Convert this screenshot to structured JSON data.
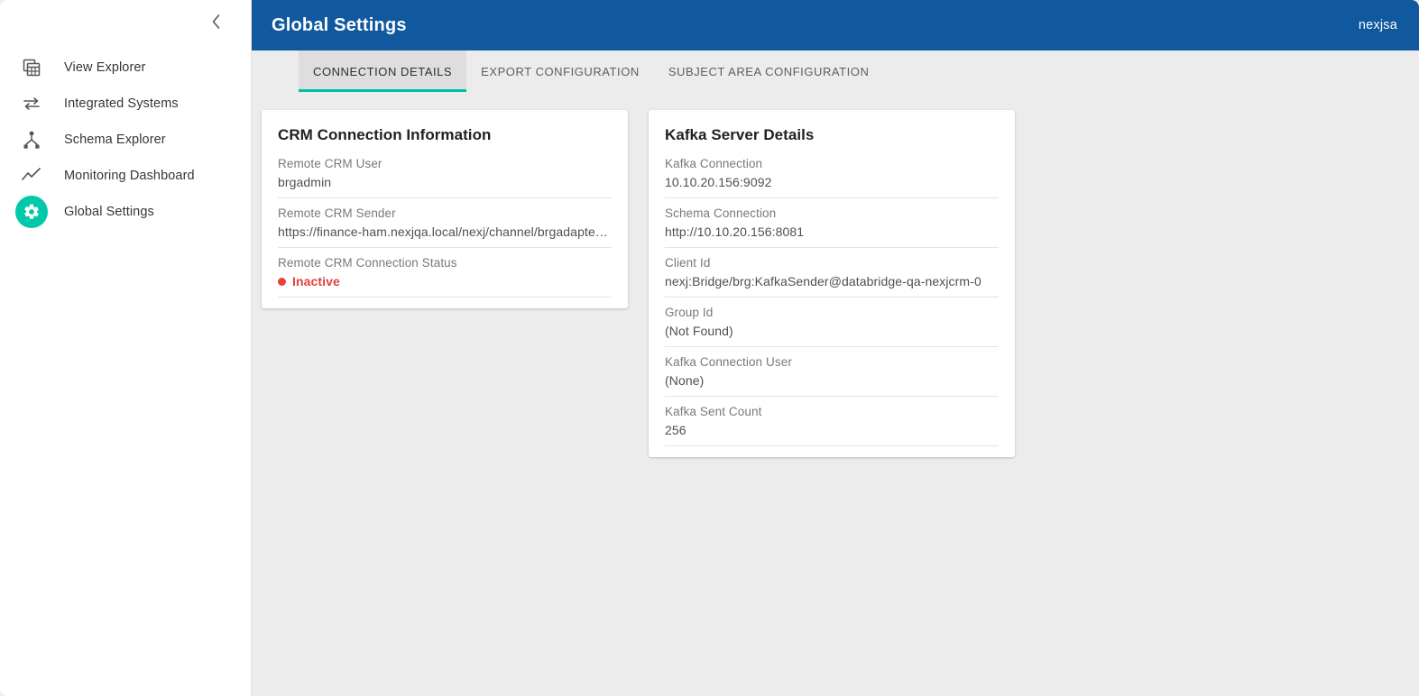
{
  "sidebar": {
    "collapse_icon": "chevron-left-icon",
    "items": [
      {
        "label": "View Explorer",
        "icon": "table-copy-icon",
        "active": false
      },
      {
        "label": "Integrated Systems",
        "icon": "exchange-arrows-icon",
        "active": false
      },
      {
        "label": "Schema Explorer",
        "icon": "sitemap-icon",
        "active": false
      },
      {
        "label": "Monitoring Dashboard",
        "icon": "line-chart-icon",
        "active": false
      },
      {
        "label": "Global Settings",
        "icon": "gear-icon",
        "active": true
      }
    ]
  },
  "topbar": {
    "title": "Global Settings",
    "user": "nexjsa",
    "bg_color": "#10599e"
  },
  "tabs": [
    {
      "label": "CONNECTION DETAILS",
      "active": true
    },
    {
      "label": "EXPORT CONFIGURATION",
      "active": false
    },
    {
      "label": "SUBJECT AREA CONFIGURATION",
      "active": false
    }
  ],
  "accent_color": "#00bfa5",
  "status_color": "#e5413d",
  "cards": {
    "crm": {
      "title": "CRM Connection Information",
      "fields": [
        {
          "label": "Remote CRM User",
          "value": "brgadmin"
        },
        {
          "label": "Remote CRM Sender",
          "value": "https://finance-ham.nexjqa.local/nexj/channel/brgadapter:C…"
        },
        {
          "label": "Remote CRM Connection Status",
          "value": "Inactive",
          "status": true
        }
      ]
    },
    "kafka": {
      "title": "Kafka Server Details",
      "fields": [
        {
          "label": "Kafka Connection",
          "value": "10.10.20.156:9092"
        },
        {
          "label": "Schema Connection",
          "value": "http://10.10.20.156:8081"
        },
        {
          "label": "Client Id",
          "value": "nexj:Bridge/brg:KafkaSender@databridge-qa-nexjcrm-0"
        },
        {
          "label": "Group Id",
          "value": "(Not Found)"
        },
        {
          "label": "Kafka Connection User",
          "value": "(None)"
        },
        {
          "label": "Kafka Sent Count",
          "value": "256"
        }
      ]
    }
  }
}
